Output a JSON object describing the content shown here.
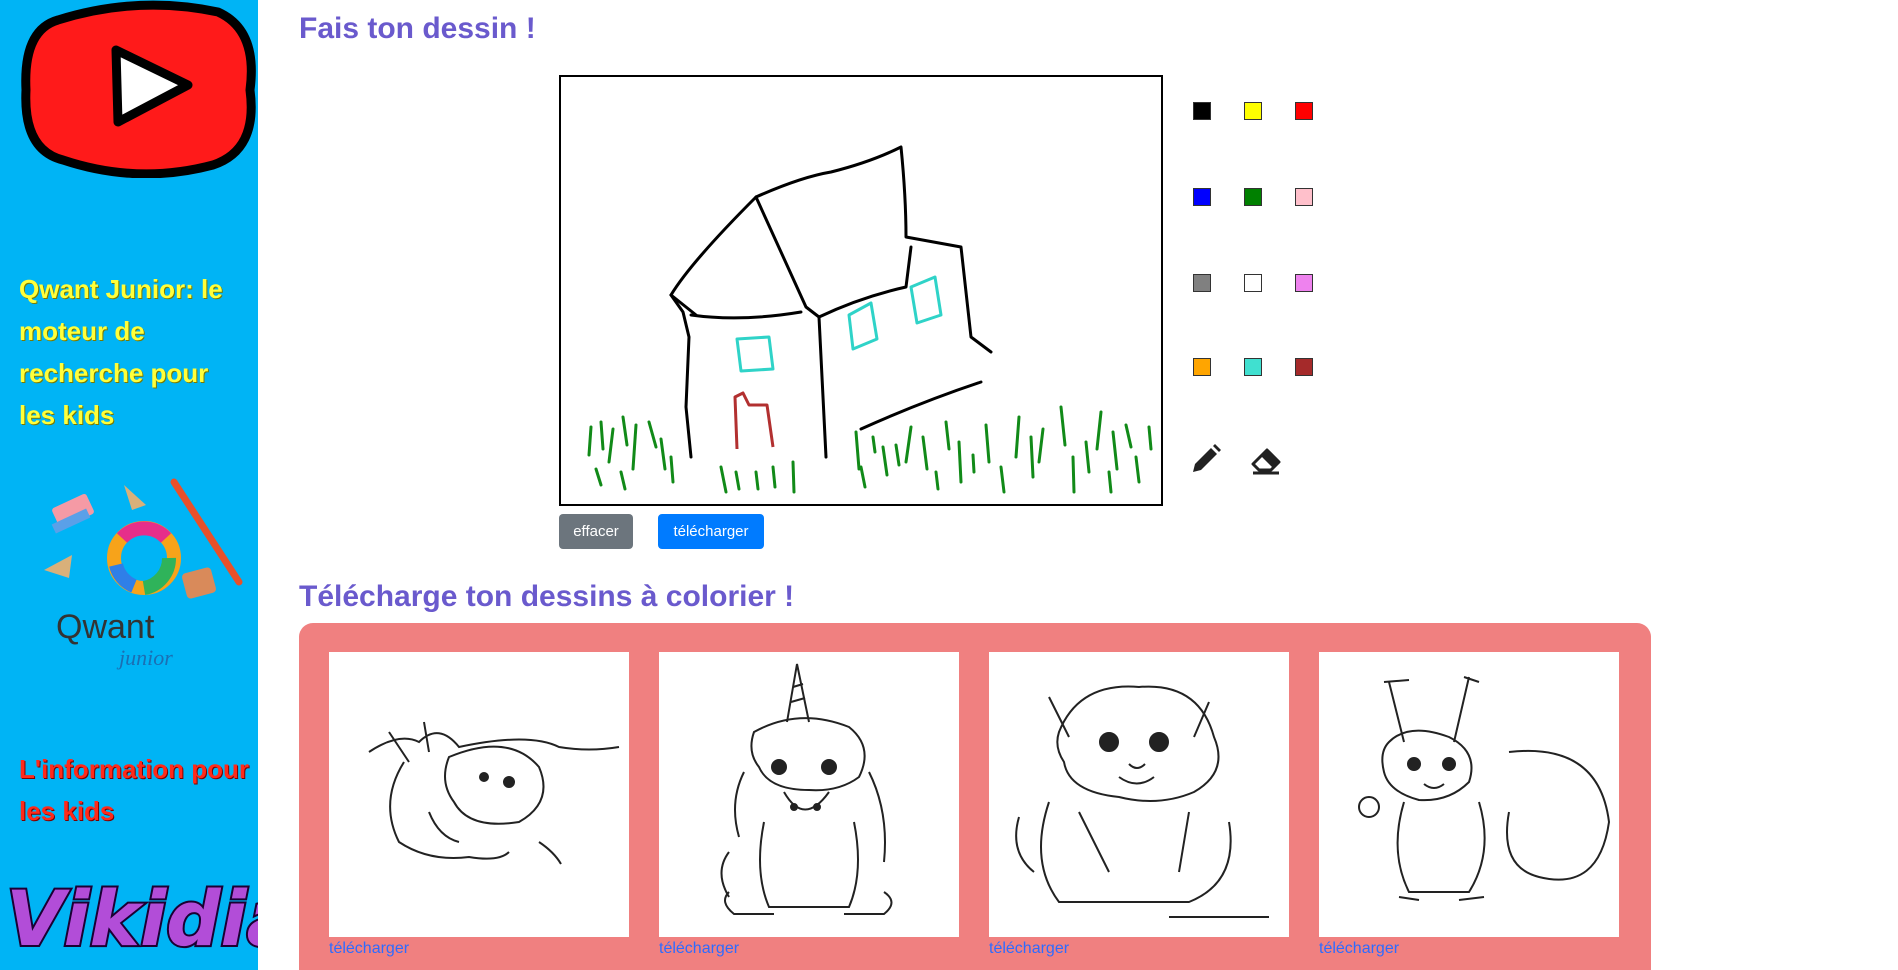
{
  "sidebar": {
    "qwant_text": "Qwant Junior: le moteur de recherche pour les kids",
    "qwant_logo_word": "Qwant",
    "qwant_logo_sub": "junior",
    "vikidia_text": "L'information pour les kids",
    "vikidia_logo_word": "Vikidia"
  },
  "drawing": {
    "title": "Fais ton dessin !",
    "clear_label": "effacer",
    "download_label": "télécharger"
  },
  "palette": {
    "colors": [
      "#000000",
      "#ffff00",
      "#ff0000",
      "#0000ff",
      "#008000",
      "#ffc0cb",
      "#808080",
      "#ffffff",
      "#ee82ee",
      "#ffa500",
      "#40e0d0",
      "#a52a2a"
    ],
    "tools": [
      "pencil-icon",
      "eraser-icon"
    ]
  },
  "coloring": {
    "title": "Télécharge ton dessins à colorier !",
    "items": [
      {
        "subject": "bunny",
        "link_label": "télécharger"
      },
      {
        "subject": "unicorn",
        "link_label": "télécharger"
      },
      {
        "subject": "puppy",
        "link_label": "télécharger"
      },
      {
        "subject": "squirrel",
        "link_label": "télécharger"
      }
    ]
  }
}
